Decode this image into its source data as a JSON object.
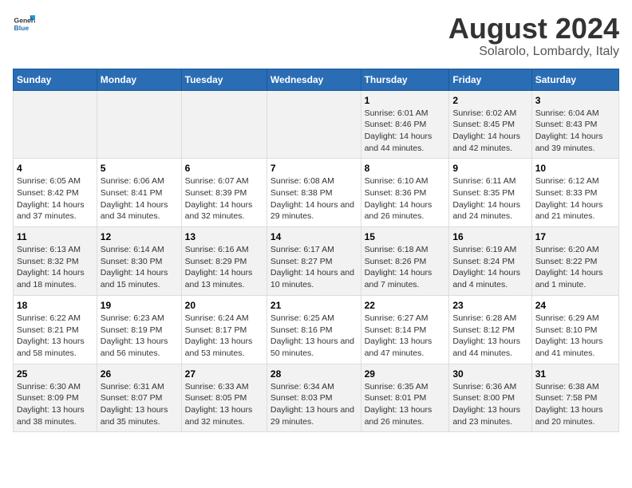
{
  "header": {
    "logo_general": "General",
    "logo_blue": "Blue",
    "main_title": "August 2024",
    "sub_title": "Solarolo, Lombardy, Italy"
  },
  "days_of_week": [
    "Sunday",
    "Monday",
    "Tuesday",
    "Wednesday",
    "Thursday",
    "Friday",
    "Saturday"
  ],
  "weeks": [
    [
      {
        "day": "",
        "info": ""
      },
      {
        "day": "",
        "info": ""
      },
      {
        "day": "",
        "info": ""
      },
      {
        "day": "",
        "info": ""
      },
      {
        "day": "1",
        "info": "Sunrise: 6:01 AM\nSunset: 8:46 PM\nDaylight: 14 hours and 44 minutes."
      },
      {
        "day": "2",
        "info": "Sunrise: 6:02 AM\nSunset: 8:45 PM\nDaylight: 14 hours and 42 minutes."
      },
      {
        "day": "3",
        "info": "Sunrise: 6:04 AM\nSunset: 8:43 PM\nDaylight: 14 hours and 39 minutes."
      }
    ],
    [
      {
        "day": "4",
        "info": "Sunrise: 6:05 AM\nSunset: 8:42 PM\nDaylight: 14 hours and 37 minutes."
      },
      {
        "day": "5",
        "info": "Sunrise: 6:06 AM\nSunset: 8:41 PM\nDaylight: 14 hours and 34 minutes."
      },
      {
        "day": "6",
        "info": "Sunrise: 6:07 AM\nSunset: 8:39 PM\nDaylight: 14 hours and 32 minutes."
      },
      {
        "day": "7",
        "info": "Sunrise: 6:08 AM\nSunset: 8:38 PM\nDaylight: 14 hours and 29 minutes."
      },
      {
        "day": "8",
        "info": "Sunrise: 6:10 AM\nSunset: 8:36 PM\nDaylight: 14 hours and 26 minutes."
      },
      {
        "day": "9",
        "info": "Sunrise: 6:11 AM\nSunset: 8:35 PM\nDaylight: 14 hours and 24 minutes."
      },
      {
        "day": "10",
        "info": "Sunrise: 6:12 AM\nSunset: 8:33 PM\nDaylight: 14 hours and 21 minutes."
      }
    ],
    [
      {
        "day": "11",
        "info": "Sunrise: 6:13 AM\nSunset: 8:32 PM\nDaylight: 14 hours and 18 minutes."
      },
      {
        "day": "12",
        "info": "Sunrise: 6:14 AM\nSunset: 8:30 PM\nDaylight: 14 hours and 15 minutes."
      },
      {
        "day": "13",
        "info": "Sunrise: 6:16 AM\nSunset: 8:29 PM\nDaylight: 14 hours and 13 minutes."
      },
      {
        "day": "14",
        "info": "Sunrise: 6:17 AM\nSunset: 8:27 PM\nDaylight: 14 hours and 10 minutes."
      },
      {
        "day": "15",
        "info": "Sunrise: 6:18 AM\nSunset: 8:26 PM\nDaylight: 14 hours and 7 minutes."
      },
      {
        "day": "16",
        "info": "Sunrise: 6:19 AM\nSunset: 8:24 PM\nDaylight: 14 hours and 4 minutes."
      },
      {
        "day": "17",
        "info": "Sunrise: 6:20 AM\nSunset: 8:22 PM\nDaylight: 14 hours and 1 minute."
      }
    ],
    [
      {
        "day": "18",
        "info": "Sunrise: 6:22 AM\nSunset: 8:21 PM\nDaylight: 13 hours and 58 minutes."
      },
      {
        "day": "19",
        "info": "Sunrise: 6:23 AM\nSunset: 8:19 PM\nDaylight: 13 hours and 56 minutes."
      },
      {
        "day": "20",
        "info": "Sunrise: 6:24 AM\nSunset: 8:17 PM\nDaylight: 13 hours and 53 minutes."
      },
      {
        "day": "21",
        "info": "Sunrise: 6:25 AM\nSunset: 8:16 PM\nDaylight: 13 hours and 50 minutes."
      },
      {
        "day": "22",
        "info": "Sunrise: 6:27 AM\nSunset: 8:14 PM\nDaylight: 13 hours and 47 minutes."
      },
      {
        "day": "23",
        "info": "Sunrise: 6:28 AM\nSunset: 8:12 PM\nDaylight: 13 hours and 44 minutes."
      },
      {
        "day": "24",
        "info": "Sunrise: 6:29 AM\nSunset: 8:10 PM\nDaylight: 13 hours and 41 minutes."
      }
    ],
    [
      {
        "day": "25",
        "info": "Sunrise: 6:30 AM\nSunset: 8:09 PM\nDaylight: 13 hours and 38 minutes."
      },
      {
        "day": "26",
        "info": "Sunrise: 6:31 AM\nSunset: 8:07 PM\nDaylight: 13 hours and 35 minutes."
      },
      {
        "day": "27",
        "info": "Sunrise: 6:33 AM\nSunset: 8:05 PM\nDaylight: 13 hours and 32 minutes."
      },
      {
        "day": "28",
        "info": "Sunrise: 6:34 AM\nSunset: 8:03 PM\nDaylight: 13 hours and 29 minutes."
      },
      {
        "day": "29",
        "info": "Sunrise: 6:35 AM\nSunset: 8:01 PM\nDaylight: 13 hours and 26 minutes."
      },
      {
        "day": "30",
        "info": "Sunrise: 6:36 AM\nSunset: 8:00 PM\nDaylight: 13 hours and 23 minutes."
      },
      {
        "day": "31",
        "info": "Sunrise: 6:38 AM\nSunset: 7:58 PM\nDaylight: 13 hours and 20 minutes."
      }
    ]
  ]
}
